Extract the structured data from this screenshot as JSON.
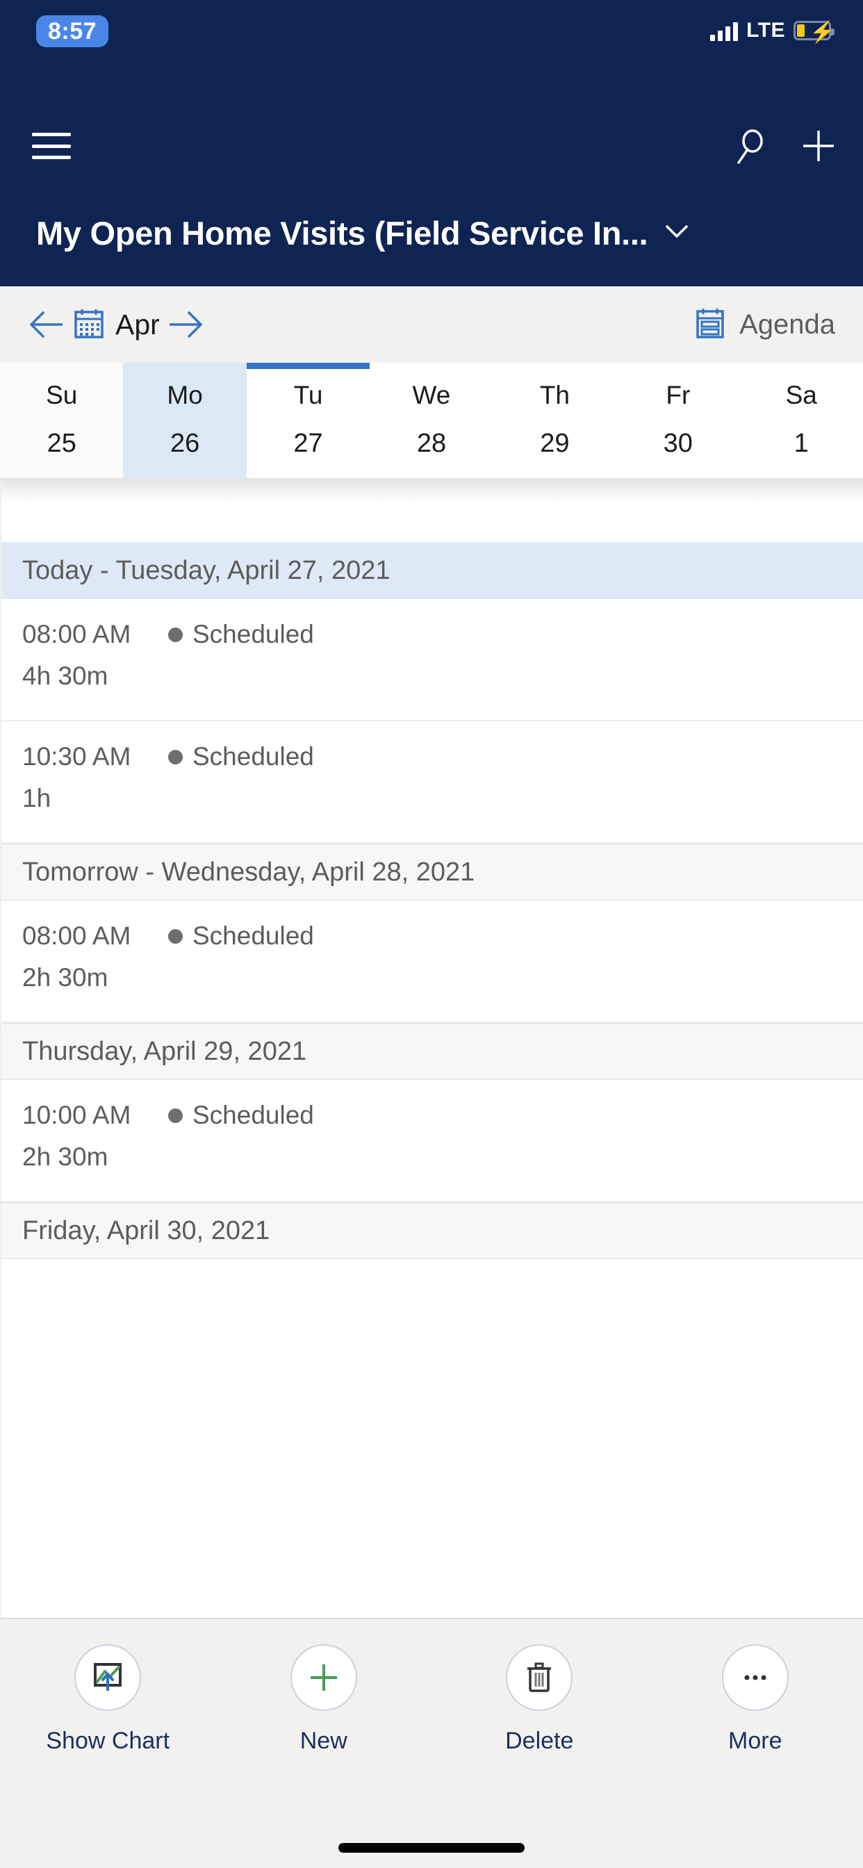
{
  "status_bar": {
    "time": "8:57",
    "network_label": "LTE",
    "signal_icon": "signal-bars-icon",
    "battery_icon": "battery-charging-icon"
  },
  "app_bar": {
    "menu_icon": "hamburger-menu-icon",
    "search_icon": "search-icon",
    "new_icon": "plus-icon",
    "view_title": "My Open Home Visits (Field Service In...",
    "view_chevron_icon": "chevron-down-icon"
  },
  "calendar_nav": {
    "prev_icon": "arrow-left-icon",
    "next_icon": "arrow-right-icon",
    "month_icon": "calendar-icon",
    "month_label": "Apr",
    "agenda_icon": "agenda-icon",
    "agenda_label": "Agenda"
  },
  "week_strip": {
    "days": [
      {
        "name": "Su",
        "num": "25",
        "other_month": true,
        "selected": false,
        "today": false
      },
      {
        "name": "Mo",
        "num": "26",
        "other_month": false,
        "selected": true,
        "today": false
      },
      {
        "name": "Tu",
        "num": "27",
        "other_month": false,
        "selected": false,
        "today": true
      },
      {
        "name": "We",
        "num": "28",
        "other_month": false,
        "selected": false,
        "today": false
      },
      {
        "name": "Th",
        "num": "29",
        "other_month": false,
        "selected": false,
        "today": false
      },
      {
        "name": "Fr",
        "num": "30",
        "other_month": false,
        "selected": false,
        "today": false
      },
      {
        "name": "Sa",
        "num": "1",
        "other_month": false,
        "selected": false,
        "today": false
      }
    ]
  },
  "agenda": {
    "sections": [
      {
        "header": "Today - Tuesday, April 27, 2021",
        "is_today": true,
        "appointments": [
          {
            "time": "08:00 AM",
            "status": "Scheduled",
            "duration": "4h 30m",
            "status_color": "#6e6e6e"
          },
          {
            "time": "10:30 AM",
            "status": "Scheduled",
            "duration": "1h",
            "status_color": "#6e6e6e"
          }
        ]
      },
      {
        "header": "Tomorrow - Wednesday, April 28, 2021",
        "is_today": false,
        "appointments": [
          {
            "time": "08:00 AM",
            "status": "Scheduled",
            "duration": "2h 30m",
            "status_color": "#6e6e6e"
          }
        ]
      },
      {
        "header": "Thursday, April 29, 2021",
        "is_today": false,
        "appointments": [
          {
            "time": "10:00 AM",
            "status": "Scheduled",
            "duration": "2h 30m",
            "status_color": "#6e6e6e"
          }
        ]
      },
      {
        "header": "Friday, April 30, 2021",
        "is_today": false,
        "appointments": []
      }
    ]
  },
  "command_bar": {
    "items": [
      {
        "label": "Show Chart",
        "icon": "show-chart-icon"
      },
      {
        "label": "New",
        "icon": "plus-icon"
      },
      {
        "label": "Delete",
        "icon": "trash-icon"
      },
      {
        "label": "More",
        "icon": "ellipsis-icon"
      }
    ]
  },
  "colors": {
    "app_bar_bg": "#0f2452",
    "accent_blue": "#3473c4",
    "selected_day_bg": "#dbe8f6",
    "today_section_bg": "#dde9f6",
    "section_bg": "#f7f7f6",
    "command_label": "#1b2f5e",
    "new_green": "#4a9c5a"
  }
}
